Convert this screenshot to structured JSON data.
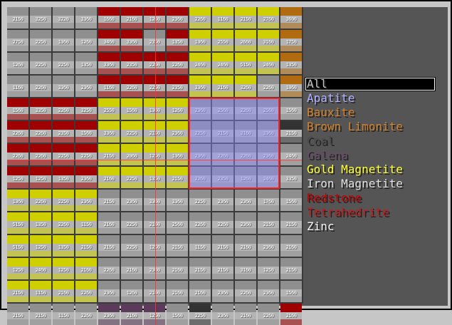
{
  "filter_list": {
    "items": [
      {
        "label": "All",
        "color": "#c6c6c6",
        "selected": true
      },
      {
        "label": "Apatite",
        "color": "#b0b0ff",
        "selected": false
      },
      {
        "label": "Bauxite",
        "color": "#d3812a",
        "selected": false
      },
      {
        "label": "Brown Limonite",
        "color": "#d3812a",
        "selected": false
      },
      {
        "label": "Coal",
        "color": "#4a4a4a",
        "selected": false
      },
      {
        "label": "Galena",
        "color": "#6a4c6a",
        "selected": false
      },
      {
        "label": "Gold Magnetite",
        "color": "#ffff33",
        "selected": false
      },
      {
        "label": "Iron Magnetite",
        "color": "#e0e0e0",
        "selected": false
      },
      {
        "label": "Redstone",
        "color": "#c40000",
        "selected": false
      },
      {
        "label": "Tetrahedrite",
        "color": "#c41a1a",
        "selected": false
      },
      {
        "label": "Zinc",
        "color": "#f2f2f2",
        "selected": false
      }
    ]
  },
  "colors": {
    "gray": "#8f8f8f",
    "gray_light": "#b4b4b4",
    "red": "#9e0000",
    "yellow": "#cfcf00",
    "orange": "#b06a10",
    "coal": "#333333",
    "galena": "#5a3c5a",
    "highlight_border": "#ff2020"
  },
  "ore_map": {
    "rows": [
      {
        "types": [
          "gray",
          "gray",
          "gray",
          "gray",
          "red",
          "red",
          "red",
          "red",
          "yellow",
          "yellow",
          "yellow",
          "yellow",
          "orange"
        ],
        "values": [
          "2150",
          "3250",
          "3220",
          "3360",
          "1660",
          "2160",
          "1260",
          "2360",
          "2260",
          "1160",
          "2150",
          "2760",
          "3600"
        ]
      },
      {
        "types": [
          "gray",
          "gray",
          "gray",
          "gray",
          "red",
          "red",
          "gray",
          "red",
          "yellow",
          "yellow",
          "yellow",
          "yellow",
          "orange"
        ],
        "values": [
          "2750",
          "2250",
          "1360",
          "1260",
          "3460",
          "3360",
          "2350",
          "1350",
          "1360",
          "2550",
          "2660",
          "3160",
          "1750"
        ]
      },
      {
        "types": [
          "gray",
          "gray",
          "gray",
          "gray",
          "red",
          "red",
          "red",
          "red",
          "yellow",
          "yellow",
          "yellow",
          "yellow",
          "orange"
        ],
        "values": [
          "1260",
          "2250",
          "2250",
          "1350",
          "3360",
          "2350",
          "2260",
          "2260",
          "2460",
          "2460",
          "5150",
          "2460",
          "1350"
        ]
      },
      {
        "types": [
          "gray",
          "gray",
          "gray",
          "gray",
          "red",
          "red",
          "red",
          "red",
          "yellow",
          "yellow",
          "yellow",
          "gray",
          "orange"
        ],
        "values": [
          "1160",
          "2260",
          "3360",
          "2360",
          "1160",
          "2260",
          "2250",
          "2350",
          "3360",
          "2160",
          "3260",
          "2260",
          "1060"
        ]
      },
      {
        "types": [
          "red",
          "red",
          "red",
          "red",
          "yellow",
          "yellow",
          "yellow",
          "yellow",
          "gray",
          "gray",
          "gray",
          "gray",
          "gray"
        ],
        "values": [
          "1560",
          "3350",
          "2260",
          "3250",
          "2550",
          "1560",
          "1360",
          "1260",
          "2360",
          "2560",
          "2260",
          "2560",
          "1560"
        ]
      },
      {
        "types": [
          "red",
          "red",
          "red",
          "red",
          "yellow",
          "yellow",
          "yellow",
          "yellow",
          "gray",
          "gray",
          "gray",
          "gray",
          "coal"
        ],
        "values": [
          "2260",
          "2260",
          "2350",
          "1560",
          "3360",
          "2250",
          "2150",
          "2360",
          "2250",
          "2150",
          "3160",
          "3360",
          "2150"
        ]
      },
      {
        "types": [
          "red",
          "red",
          "red",
          "red",
          "yellow",
          "yellow",
          "yellow",
          "yellow",
          "gray",
          "gray",
          "gray",
          "gray",
          "gray"
        ],
        "values": [
          "2260",
          "2260",
          "2250",
          "2250",
          "2150",
          "2060",
          "1250",
          "1360",
          "2360",
          "2260",
          "2260",
          "2360",
          "2460"
        ]
      },
      {
        "types": [
          "red",
          "red",
          "red",
          "red",
          "yellow",
          "yellow",
          "yellow",
          "yellow",
          "gray",
          "gray",
          "gray",
          "gray",
          "gray"
        ],
        "values": [
          "1250",
          "1250",
          "1350",
          "2360",
          "2160",
          "2250",
          "1350",
          "2150",
          "2260",
          "2350",
          "1260",
          "2460",
          "3350"
        ]
      },
      {
        "types": [
          "yellow",
          "yellow",
          "yellow",
          "yellow",
          "gray",
          "gray",
          "gray",
          "gray",
          "gray",
          "gray",
          "gray",
          "gray",
          "gray"
        ],
        "values": [
          "1360",
          "2260",
          "2250",
          "2360",
          "2150",
          "2360",
          "3360",
          "3360",
          "2250",
          "2360",
          "2360",
          "1760",
          "1560"
        ]
      },
      {
        "types": [
          "yellow",
          "yellow",
          "yellow",
          "yellow",
          "gray",
          "gray",
          "gray",
          "gray",
          "gray",
          "gray",
          "gray",
          "gray",
          "gray"
        ],
        "values": [
          "5150",
          "1350",
          "2260",
          "1150",
          "2160",
          "2250",
          "2160",
          "2560",
          "2260",
          "2260",
          "2360",
          "2150",
          "2150"
        ]
      },
      {
        "types": [
          "yellow",
          "yellow",
          "yellow",
          "yellow",
          "gray",
          "gray",
          "gray",
          "gray",
          "gray",
          "gray",
          "gray",
          "gray",
          "gray"
        ],
        "values": [
          "5150",
          "1250",
          "1350",
          "2150",
          "2150",
          "2250",
          "1250",
          "2150",
          "1150",
          "2150",
          "2160",
          "2360",
          "2160"
        ]
      },
      {
        "types": [
          "yellow",
          "yellow",
          "yellow",
          "yellow",
          "gray",
          "gray",
          "gray",
          "gray",
          "gray",
          "gray",
          "gray",
          "gray",
          "gray"
        ],
        "values": [
          "1250",
          "2460",
          "1250",
          "2160",
          "2260",
          "2160",
          "2360",
          "2160",
          "2150",
          "2150",
          "3160",
          "1250",
          "2150"
        ]
      },
      {
        "types": [
          "yellow",
          "yellow",
          "yellow",
          "yellow",
          "gray",
          "gray",
          "gray",
          "gray",
          "gray",
          "gray",
          "gray",
          "gray",
          "gray"
        ],
        "values": [
          "2150",
          "1150",
          "2160",
          "2260",
          "2360",
          "1260",
          "2160",
          "2160",
          "2160",
          "2360",
          "2260",
          "2360",
          "1560"
        ]
      },
      {
        "types": [
          "gray",
          "gray",
          "gray",
          "gray",
          "galena",
          "galena",
          "galena",
          "gray",
          "coal",
          "gray",
          "gray",
          "gray",
          "red"
        ],
        "values": [
          "2150",
          "2150",
          "1150",
          "2260",
          "2360",
          "2160",
          "1250",
          "1560",
          "2250",
          "2360",
          "2160",
          "2260",
          "2160"
        ]
      }
    ],
    "highlighted_area": {
      "row_start": 4,
      "row_end": 7,
      "col_start": 8,
      "col_end": 11
    },
    "cursor": {
      "row": 7,
      "col": 6
    }
  }
}
